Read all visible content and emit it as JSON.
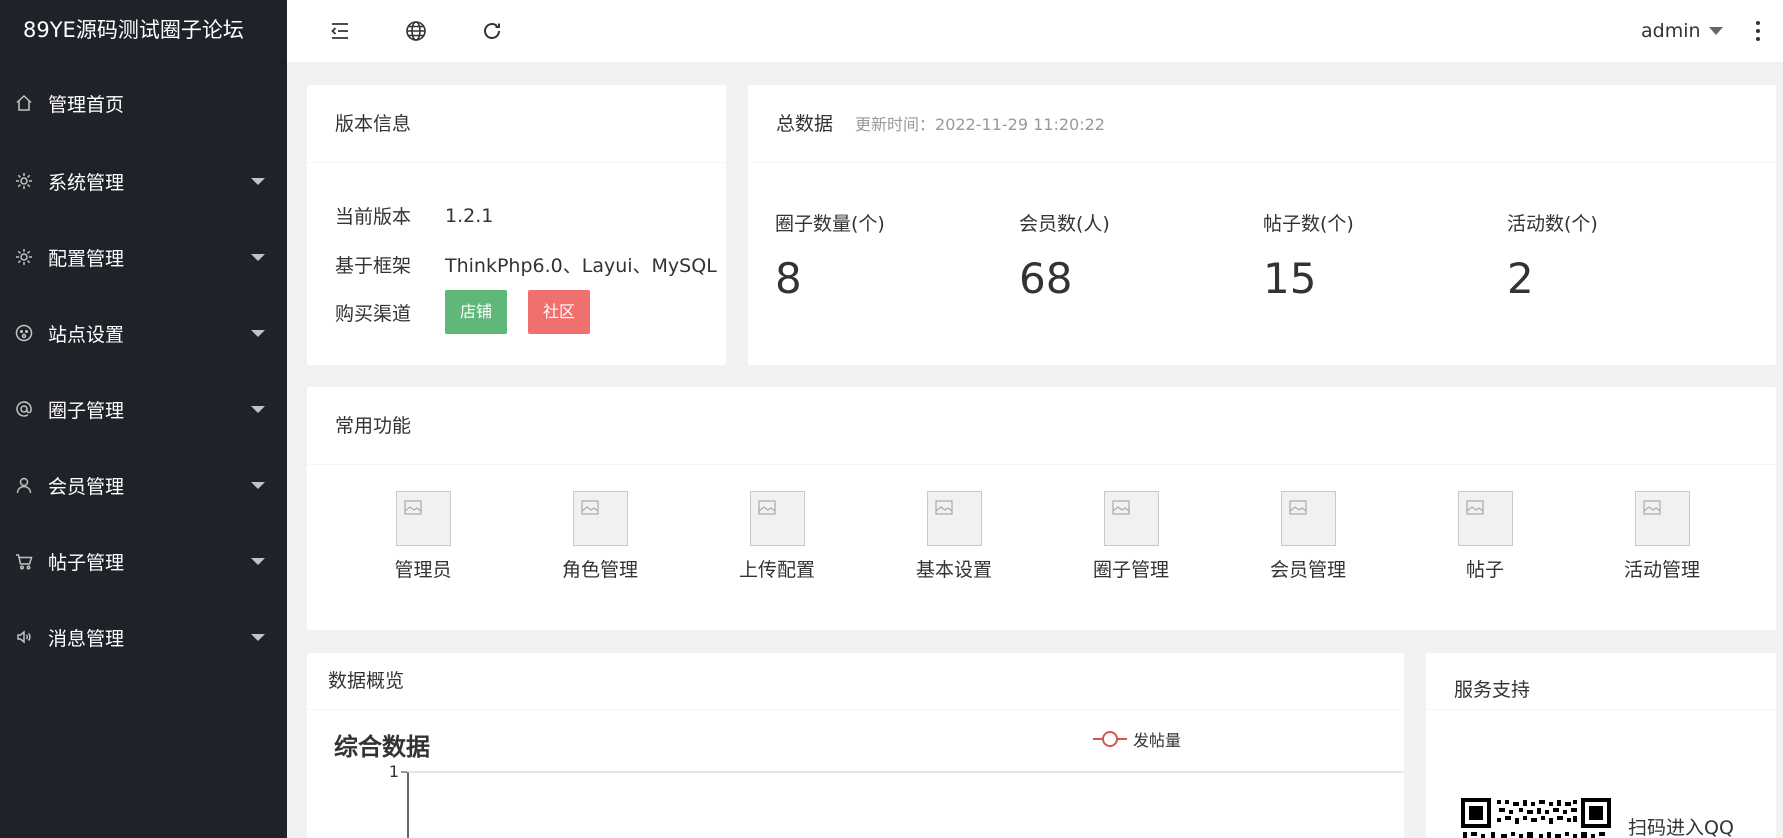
{
  "sidebar": {
    "logo": "89YE源码测试圈子论坛",
    "items": [
      {
        "label": "管理首页",
        "icon": "home-icon",
        "has_sub": false
      },
      {
        "label": "系统管理",
        "icon": "gear-icon",
        "has_sub": true
      },
      {
        "label": "配置管理",
        "icon": "gear-icon",
        "has_sub": true
      },
      {
        "label": "站点设置",
        "icon": "face-icon",
        "has_sub": true
      },
      {
        "label": "圈子管理",
        "icon": "at-icon",
        "has_sub": true
      },
      {
        "label": "会员管理",
        "icon": "user-icon",
        "has_sub": true
      },
      {
        "label": "帖子管理",
        "icon": "cart-icon",
        "has_sub": true
      },
      {
        "label": "消息管理",
        "icon": "speaker-icon",
        "has_sub": true
      }
    ]
  },
  "header": {
    "user": "admin"
  },
  "version": {
    "title": "版本信息",
    "rows": [
      {
        "label": "当前版本",
        "value": "1.2.1"
      },
      {
        "label": "基于框架",
        "value": "ThinkPhp6.0、Layui、MySQL"
      },
      {
        "label": "购买渠道"
      }
    ],
    "buttons": {
      "shop": "店铺",
      "community": "社区"
    }
  },
  "totals": {
    "title": "总数据",
    "updated": "更新时间：2022-11-29 11:20:22",
    "stats": [
      {
        "label": "圈子数量(个)",
        "value": "8"
      },
      {
        "label": "会员数(人)",
        "value": "68"
      },
      {
        "label": "帖子数(个)",
        "value": "15"
      },
      {
        "label": "活动数(个)",
        "value": "2"
      }
    ]
  },
  "quick": {
    "title": "常用功能",
    "items": [
      "管理员",
      "角色管理",
      "上传配置",
      "基本设置",
      "圈子管理",
      "会员管理",
      "帖子",
      "活动管理"
    ]
  },
  "overview": {
    "title": "数据概览"
  },
  "chart_data": {
    "type": "line",
    "title": "综合数据",
    "series": [
      {
        "name": "发帖量",
        "values": []
      }
    ],
    "y_tick_labels": [
      "1"
    ],
    "colors": {
      "series": "#d9534f"
    }
  },
  "support": {
    "title": "服务支持",
    "qr_text": "扫码进入QQ"
  }
}
